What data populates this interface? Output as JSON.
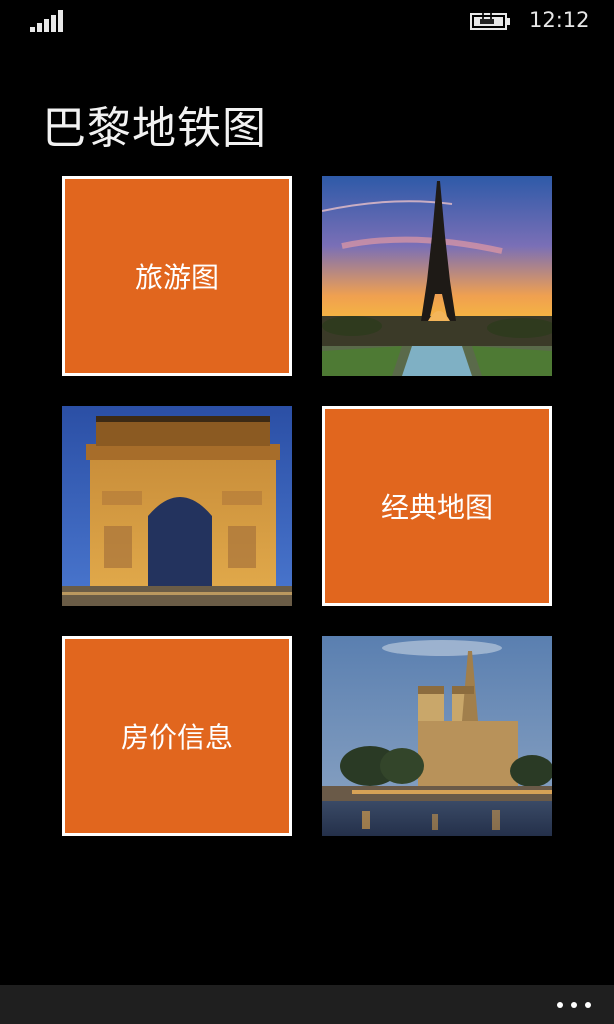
{
  "status_bar": {
    "time": "12:12",
    "icons": [
      "signal-strength-icon",
      "battery-charging-icon"
    ]
  },
  "page": {
    "title": "巴黎地铁图"
  },
  "tiles": [
    {
      "label": "旅游图",
      "kind": "text",
      "color": "#e1661e"
    },
    {
      "kind": "photo",
      "image": "eiffel-tower-sunset"
    },
    {
      "kind": "photo",
      "image": "arc-de-triomphe-night"
    },
    {
      "label": "经典地图",
      "kind": "text",
      "color": "#e1661e"
    },
    {
      "label": "房价信息",
      "kind": "text",
      "color": "#e1661e"
    },
    {
      "kind": "photo",
      "image": "notre-dame-dusk"
    }
  ],
  "app_bar": {
    "icons": [
      "more-options-icon"
    ]
  },
  "colors": {
    "accent": "#e1661e",
    "background": "#000000",
    "app_bar": "#1f1f1f"
  }
}
